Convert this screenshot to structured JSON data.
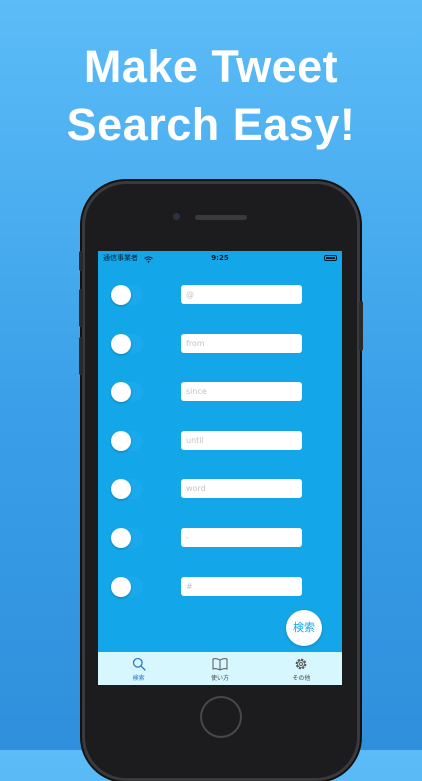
{
  "headline": {
    "line1": "Make Tweet",
    "line2": "Search Easy!"
  },
  "statusbar": {
    "carrier": "通信事業者",
    "time": "9:25",
    "wifi_icon": "wifi-icon",
    "battery_icon": "battery-icon"
  },
  "rows": [
    {
      "placeholder": "@",
      "toggle_on": false
    },
    {
      "placeholder": "from",
      "toggle_on": false
    },
    {
      "placeholder": "since",
      "toggle_on": false
    },
    {
      "placeholder": "until",
      "toggle_on": false
    },
    {
      "placeholder": "word",
      "toggle_on": false
    },
    {
      "placeholder": "-",
      "toggle_on": false
    },
    {
      "placeholder": "#",
      "toggle_on": false
    }
  ],
  "search_button": {
    "label": "検索"
  },
  "tabbar": {
    "tabs": [
      {
        "label": "検索",
        "icon": "magnifier-icon",
        "active": true
      },
      {
        "label": "使い方",
        "icon": "book-icon",
        "active": false
      },
      {
        "label": "その他",
        "icon": "gear-icon",
        "active": false
      }
    ]
  },
  "colors": {
    "screen": "#13a7ea",
    "tabbar": "#d7f7ff",
    "accent": "#2a7ac8"
  }
}
